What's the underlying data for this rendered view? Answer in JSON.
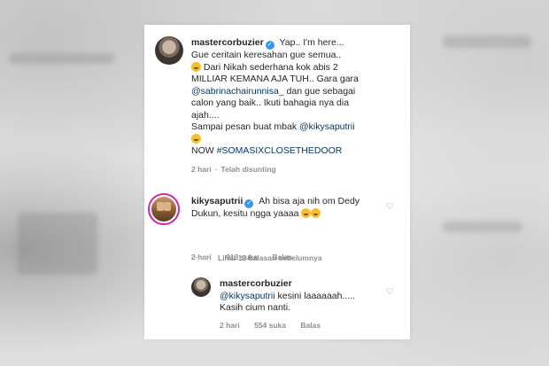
{
  "comments": [
    {
      "username": "mastercorbuzier",
      "lines": [
        "Yap.. I'm here...",
        "Gue ceritain keresahan gue semua..",
        " Dari Nikah sederhana kok abis 2",
        "MILLIAR KEMANA AJA TUH.. Gara gara",
        "@sabrinachairunnisa_",
        " dan gue sebagai",
        "calon yang baik.. Ikuti bahagia nya dia",
        "ajah....",
        "Sampai pesan buat mbak ",
        "@kikysaputrii",
        "NOW ",
        "#SOMASIXCLOSETHEDOOR"
      ],
      "time": "2 hari",
      "status": "Telah disunting"
    },
    {
      "username": "kikysaputrii",
      "lines": [
        "Ah bisa aja nih om Dedy",
        "Dukun, kesitu ngga yaaaa"
      ],
      "time": "2 hari",
      "likes": "913 suka",
      "reply_label": "Balas"
    }
  ],
  "view_replies": "Lihat 12 balasan sebelumnya",
  "reply": {
    "username": "mastercorbuzier",
    "mention": "@kikysaputrii",
    "lines": [
      " kesini laaaaaah.....",
      "Kasih cium nanti."
    ],
    "time": "2 hari",
    "likes": "554 suka",
    "reply_label": "Balas"
  },
  "icons": {
    "verified": "verified-badge-icon",
    "like": "heart-icon",
    "emoji": "emoji-icon"
  },
  "colors": {
    "mention": "#00376b",
    "verified": "#3897f0",
    "meta": "#8e8e8e"
  }
}
